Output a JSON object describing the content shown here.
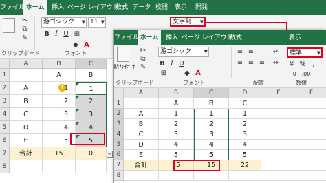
{
  "back_window": {
    "tabs": [
      "ファイル",
      "ホーム",
      "挿入",
      "ページ レイアウト",
      "数式",
      "データ",
      "校閲",
      "表示",
      "開発"
    ],
    "active_tab": 1,
    "font_name": "游ゴシック",
    "font_size": "11",
    "number_format": "文字列",
    "group_labels": {
      "clipboard": "クリップボード",
      "font": "フォント"
    },
    "col_headers": [
      "A",
      "B",
      "C"
    ],
    "row_headers": [
      "1",
      "2",
      "3",
      "4",
      "5",
      "6",
      "7",
      "8"
    ],
    "rows": [
      [
        "",
        "A",
        "B"
      ],
      [
        "A",
        "1",
        "1"
      ],
      [
        "B",
        "2",
        "2"
      ],
      [
        "C",
        "3",
        "3"
      ],
      [
        "D",
        "4",
        "4"
      ],
      [
        "E",
        "5",
        "5"
      ],
      [
        "合計",
        "15",
        "0"
      ],
      [
        "",
        "",
        ""
      ]
    ]
  },
  "front_window": {
    "tabs": [
      "ファイル",
      "ホーム",
      "挿入",
      "ページ レイアウト",
      "数式",
      "表示"
    ],
    "active_tab": 1,
    "font_name": "游ゴシック",
    "number_format": "標準",
    "paste_label": "貼り付け",
    "group_labels": {
      "clipboard": "クリップボード",
      "font": "フォント",
      "alignment": "配置",
      "number": "数値"
    },
    "col_headers": [
      "A",
      "B",
      "C",
      "D",
      "E",
      "F"
    ],
    "row_headers": [
      "1",
      "2",
      "3",
      "4",
      "5",
      "6",
      "7",
      "8"
    ],
    "rows": [
      [
        "",
        "A",
        "B",
        "C",
        "",
        ""
      ],
      [
        "A",
        "1",
        "1",
        "1",
        "",
        ""
      ],
      [
        "B",
        "2",
        "2",
        "2",
        "",
        ""
      ],
      [
        "C",
        "3",
        "3",
        "3",
        "",
        ""
      ],
      [
        "D",
        "4",
        "4",
        "4",
        "",
        ""
      ],
      [
        "E",
        "5",
        "5",
        "5",
        "",
        ""
      ],
      [
        "合計",
        "15",
        "15",
        "22",
        "",
        ""
      ],
      [
        "",
        "",
        "",
        "",
        "",
        ""
      ]
    ]
  },
  "icons": {
    "bold": "B",
    "italic": "I",
    "underline": "U",
    "font_color": "A",
    "currency": "¥",
    "percent": "%"
  },
  "colors": {
    "excel_green": "#217346",
    "highlight_red": "#e0001a",
    "total_row_fill": "#fdf1d2",
    "selected_fill": "#d8d8d8"
  }
}
